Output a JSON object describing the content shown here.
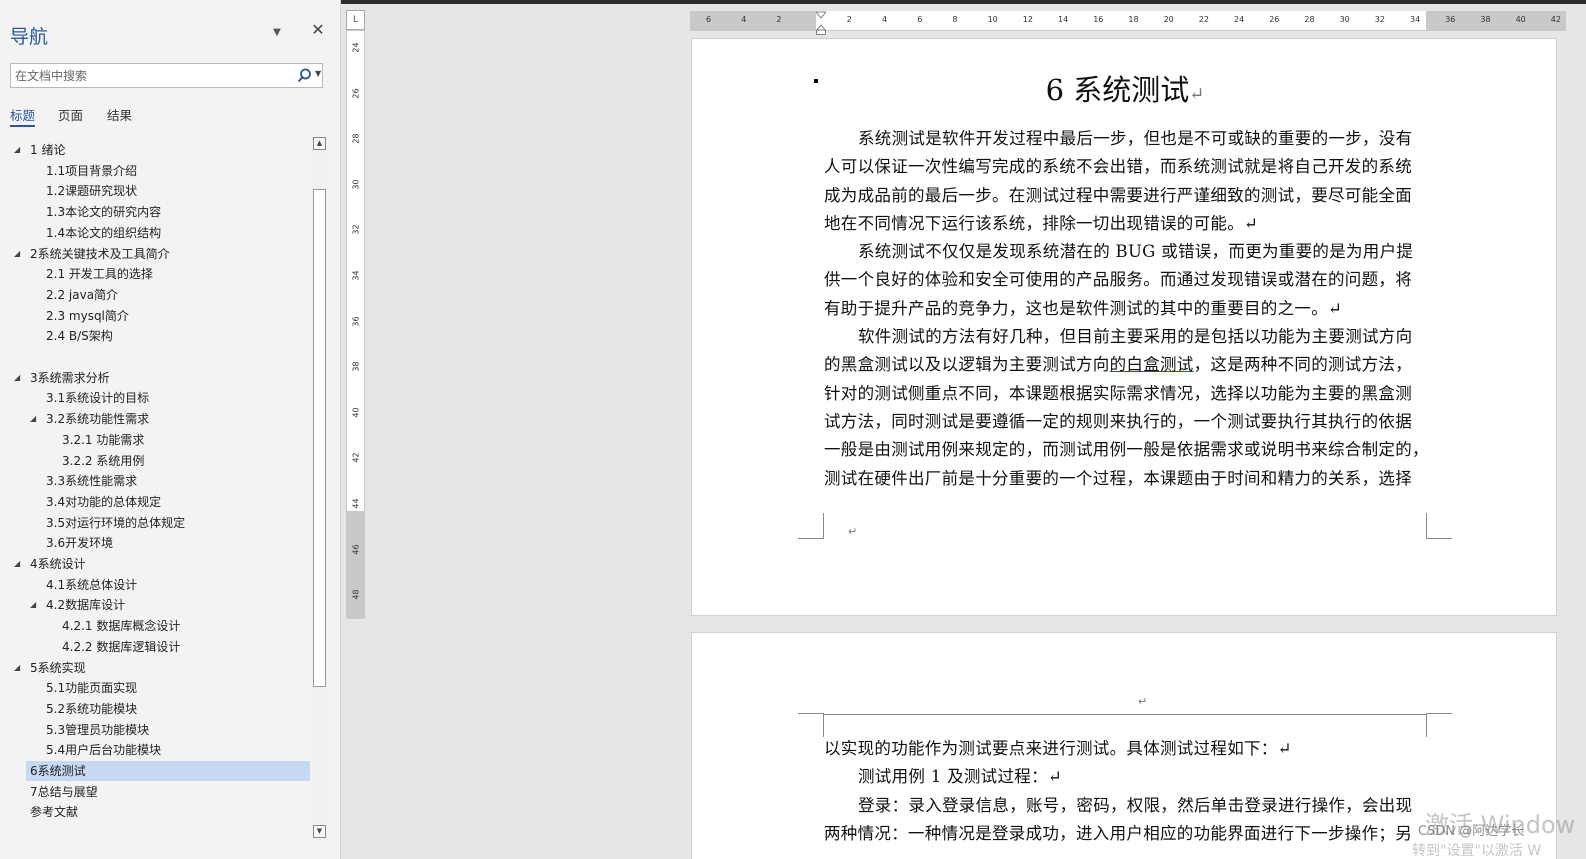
{
  "nav": {
    "title": "导航",
    "search_placeholder": "在文档中搜索",
    "tabs": [
      {
        "label": "标题",
        "active": true
      },
      {
        "label": "页面",
        "active": false
      },
      {
        "label": "结果",
        "active": false
      }
    ],
    "headings": [
      {
        "label": "1 绪论",
        "level": 1,
        "expanded": true,
        "selected": false
      },
      {
        "label": "1.1项目背景介绍",
        "level": 2,
        "selected": false
      },
      {
        "label": "1.2课题研究现状",
        "level": 2,
        "selected": false
      },
      {
        "label": "1.3本论文的研究内容",
        "level": 2,
        "selected": false
      },
      {
        "label": "1.4本论文的组织结构",
        "level": 2,
        "selected": false
      },
      {
        "label": "2系统关键技术及工具简介",
        "level": 1,
        "expanded": true,
        "selected": false
      },
      {
        "label": "2.1 开发工具的选择",
        "level": 2,
        "selected": false
      },
      {
        "label": "2.2 java简介",
        "level": 2,
        "selected": false
      },
      {
        "label": "2.3 mysql简介",
        "level": 2,
        "selected": false
      },
      {
        "label": "2.4 B/S架构",
        "level": 2,
        "selected": false
      },
      {
        "label": "",
        "level": 2,
        "selected": false
      },
      {
        "label": "3系统需求分析",
        "level": 1,
        "expanded": true,
        "selected": false
      },
      {
        "label": "3.1系统设计的目标",
        "level": 2,
        "selected": false
      },
      {
        "label": "3.2系统功能性需求",
        "level": 2,
        "expanded": true,
        "selected": false
      },
      {
        "label": "3.2.1 功能需求",
        "level": 3,
        "selected": false
      },
      {
        "label": "3.2.2 系统用例",
        "level": 3,
        "selected": false
      },
      {
        "label": "3.3系统性能需求",
        "level": 2,
        "selected": false
      },
      {
        "label": "3.4对功能的总体规定",
        "level": 2,
        "selected": false
      },
      {
        "label": "3.5对运行环境的总体规定",
        "level": 2,
        "selected": false
      },
      {
        "label": "3.6开发环境",
        "level": 2,
        "selected": false
      },
      {
        "label": "4系统设计",
        "level": 1,
        "expanded": true,
        "selected": false
      },
      {
        "label": "4.1系统总体设计",
        "level": 2,
        "selected": false
      },
      {
        "label": "4.2数据库设计",
        "level": 2,
        "expanded": true,
        "selected": false
      },
      {
        "label": "4.2.1 数据库概念设计",
        "level": 3,
        "selected": false
      },
      {
        "label": "4.2.2 数据库逻辑设计",
        "level": 3,
        "selected": false
      },
      {
        "label": "5系统实现",
        "level": 1,
        "expanded": true,
        "selected": false
      },
      {
        "label": "5.1功能页面实现",
        "level": 2,
        "selected": false
      },
      {
        "label": "5.2系统功能模块",
        "level": 2,
        "selected": false
      },
      {
        "label": "5.3管理员功能模块",
        "level": 2,
        "selected": false
      },
      {
        "label": "5.4用户后台功能模块",
        "level": 2,
        "selected": false
      },
      {
        "label": "6系统测试",
        "level": 1,
        "selected": true
      },
      {
        "label": "7总结与展望",
        "level": 1,
        "selected": false
      },
      {
        "label": "参考文献",
        "level": 1,
        "selected": false
      }
    ]
  },
  "vruler": {
    "corner": "L",
    "numbers": [
      "24",
      "26",
      "28",
      "30",
      "32",
      "34",
      "36",
      "38",
      "40",
      "42",
      "44",
      "46",
      "48"
    ]
  },
  "hruler": {
    "numbers": [
      "6",
      "4",
      "2",
      "",
      "2",
      "4",
      "6",
      "8",
      "10",
      "12",
      "14",
      "16",
      "18",
      "20",
      "22",
      "24",
      "26",
      "28",
      "30",
      "32",
      "34",
      "36",
      "38",
      "40",
      "42"
    ]
  },
  "document": {
    "title": "6 系统测试",
    "pilcrow": "↵",
    "page1_lines": [
      {
        "text": "系统测试是软件开发过程中最后一步，但也是不可或缺的重要的一步，没有",
        "indent": true
      },
      {
        "text": "人可以保证一次性编写完成的系统不会出错，而系统测试就是将自己开发的系统",
        "indent": false
      },
      {
        "text": "成为成品前的最后一步。在测试过程中需要进行严谨细致的测试，要尽可能全面",
        "indent": false
      },
      {
        "text": "地在不同情况下运行该系统，排除一切出现错误的可能。↵",
        "indent": false
      },
      {
        "text": "系统测试不仅仅是发现系统潜在的 BUG 或错误，而更为重要的是为用户提",
        "indent": true
      },
      {
        "text": "供一个良好的体验和安全可使用的产品服务。而通过发现错误或潜在的问题，将",
        "indent": false
      },
      {
        "text": "有助于提升产品的竞争力，这也是软件测试的其中的重要目的之一。↵",
        "indent": false
      },
      {
        "text": "软件测试的方法有好几种，但目前主要采用的是包括以功能为主要测试方向",
        "indent": true
      },
      {
        "text": "的黑盒测试以及以逻辑为主要测试方向的白盒测试，这是两种不同的测试方法，",
        "indent": false
      },
      {
        "text": "针对的测试侧重点不同，本课题根据实际需求情况，选择以功能为主要的黑盒测",
        "indent": false
      },
      {
        "text": "试方法，同时测试是要遵循一定的规则来执行的，一个测试要执行其执行的依据",
        "indent": false
      },
      {
        "text": "一般是由测试用例来规定的，而测试用例一般是依据需求或说明书来综合制定的，",
        "indent": false
      },
      {
        "text": "测试在硬件出厂前是十分重要的一个过程，本课题由于时间和精力的关系，选择",
        "indent": false
      }
    ],
    "page2_lines": [
      {
        "text": "以实现的功能作为测试要点来进行测试。具体测试过程如下：↵",
        "indent": false
      },
      {
        "text": "测试用例 1 及测试过程：↵",
        "indent": true
      },
      {
        "text": "登录：录入登录信息，账号，密码，权限，然后单击登录进行操作，会出现",
        "indent": true
      },
      {
        "text": "两种情况：一种情况是登录成功，进入用户相应的功能界面进行下一步操作；另",
        "indent": false
      }
    ]
  },
  "overlay": {
    "watermark": "激活 Window",
    "watermark_sub": "转到\"设置\"以激活 W",
    "csdn": "CSDN @阿达学长"
  }
}
